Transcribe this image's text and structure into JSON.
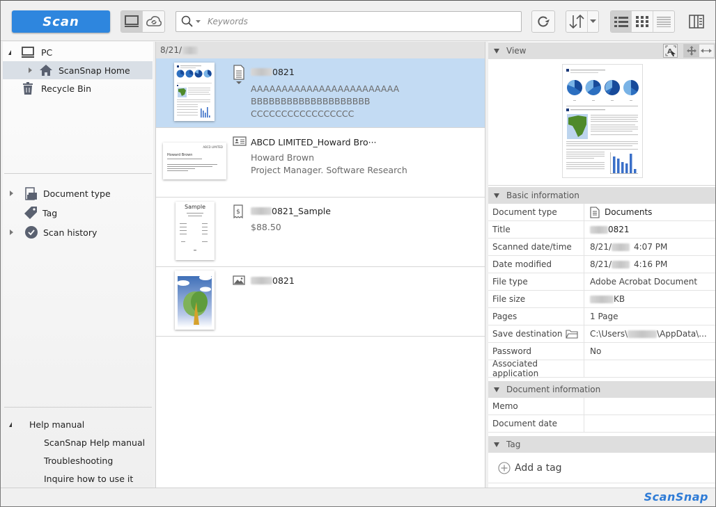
{
  "toolbar": {
    "scan_label": "Scan",
    "search_placeholder": "Keywords",
    "icons": {
      "local": "computer-icon",
      "cloud": "cloud-sync-icon",
      "search": "search-icon",
      "refresh": "refresh-icon",
      "sort": "sort-icon",
      "view_list": "list-view-icon",
      "view_thumbs": "thumbnail-view-icon",
      "view_compact": "compact-list-icon",
      "panel": "panel-layout-icon"
    },
    "active_view": "list"
  },
  "sidebar": {
    "tree": [
      {
        "label": "PC",
        "icon": "computer-icon",
        "expanded": true
      },
      {
        "label": "ScanSnap Home",
        "icon": "home-icon",
        "selected": true
      },
      {
        "label": "Recycle Bin",
        "icon": "trash-icon"
      }
    ],
    "filters": [
      {
        "label": "Document type",
        "icon": "document-type-icon"
      },
      {
        "label": "Tag",
        "icon": "tag-icon"
      },
      {
        "label": "Scan history",
        "icon": "check-circle-icon"
      }
    ],
    "help": {
      "label": "Help manual",
      "items": [
        "ScanSnap Help manual",
        "Troubleshooting",
        "Inquire how to use it"
      ]
    }
  },
  "list": {
    "date_group": "8/21/",
    "rows": [
      {
        "type": "document",
        "title_suffix": "0821",
        "lines": [
          "AAAAAAAAAAAAAAAAAAAAAAAA",
          "BBBBBBBBBBBBBBBBBBBB",
          "CCCCCCCCCCCCCCCCC"
        ],
        "selected": true
      },
      {
        "type": "business-card",
        "title": "ABCD LIMITED_Howard Bro···",
        "lines": [
          "Howard Brown",
          "Project Manager. Software Research"
        ],
        "thumb": {
          "company": "ABCD LIMITED",
          "name": "Howard Brown"
        }
      },
      {
        "type": "receipt",
        "title_suffix": "0821_Sample",
        "lines": [
          "$88.50"
        ],
        "thumb": {
          "heading": "Sample"
        }
      },
      {
        "type": "photo",
        "title_suffix": "0821",
        "lines": []
      }
    ]
  },
  "right": {
    "view": {
      "label": "View",
      "icons": [
        "text-select-icon",
        "move-icon",
        "fit-width-icon"
      ]
    },
    "basic": {
      "label": "Basic information",
      "rows": [
        {
          "key": "Document type",
          "value": "Documents",
          "icon": "document-icon"
        },
        {
          "key": "Title",
          "value": "0821",
          "redacted_prefix": true
        },
        {
          "key": "Scanned date/time",
          "value_prefix": "8/21/",
          "value": "4:07 PM"
        },
        {
          "key": "Date modified",
          "value_prefix": "8/21/",
          "value": "4:16 PM"
        },
        {
          "key": "File type",
          "value": "Adobe Acrobat Document"
        },
        {
          "key": "File size",
          "value": "KB",
          "redacted_prefix": true
        },
        {
          "key": "Pages",
          "value": "1 Page"
        },
        {
          "key": "Save destination",
          "value_prefix": "C:\\Users\\",
          "value": "\\AppData\\...",
          "key_icon": "folder-icon"
        },
        {
          "key": "Password",
          "value": "No"
        },
        {
          "key": "Associated application",
          "value": ""
        }
      ]
    },
    "docinfo": {
      "label": "Document information",
      "rows": [
        {
          "key": "Memo",
          "value": ""
        },
        {
          "key": "Document date",
          "value": ""
        }
      ]
    },
    "tag": {
      "label": "Tag",
      "add_label": "Add a tag"
    }
  },
  "status": {
    "logo": "ScanSnap"
  },
  "colors": {
    "accent": "#2e86de",
    "selection": "#c3dbf3",
    "sidebar_selection": "#d9dfe6",
    "logo": "#2e7bd6"
  }
}
